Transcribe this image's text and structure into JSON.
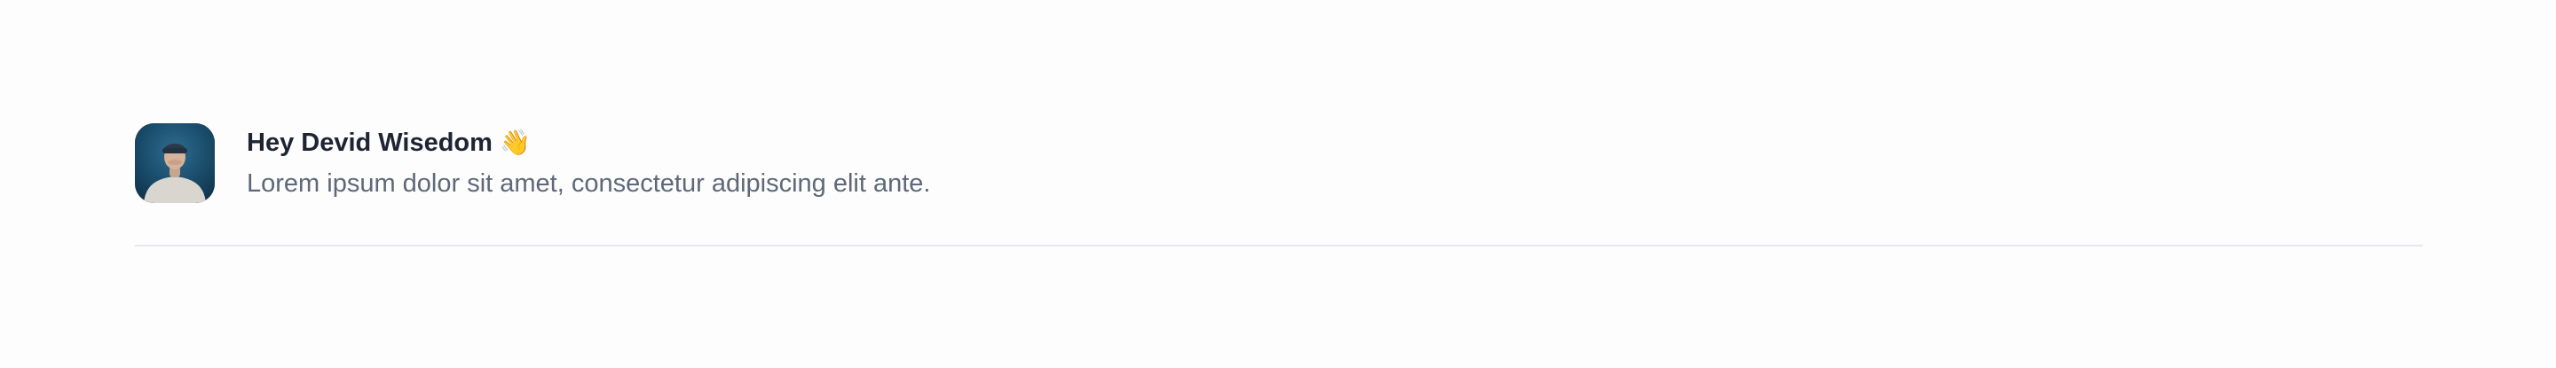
{
  "profile": {
    "greeting": "Hey Devid Wisedom",
    "wave_icon": "waving-hand-icon",
    "wave_glyph": "👋",
    "subtitle": "Lorem ipsum dolor sit amet, consectetur adipiscing elit ante."
  },
  "colors": {
    "greeting_text": "#1d2433",
    "subtitle_text": "#5e6878",
    "divider": "#e7e8eb",
    "avatar_background": "#1b4f6e"
  }
}
